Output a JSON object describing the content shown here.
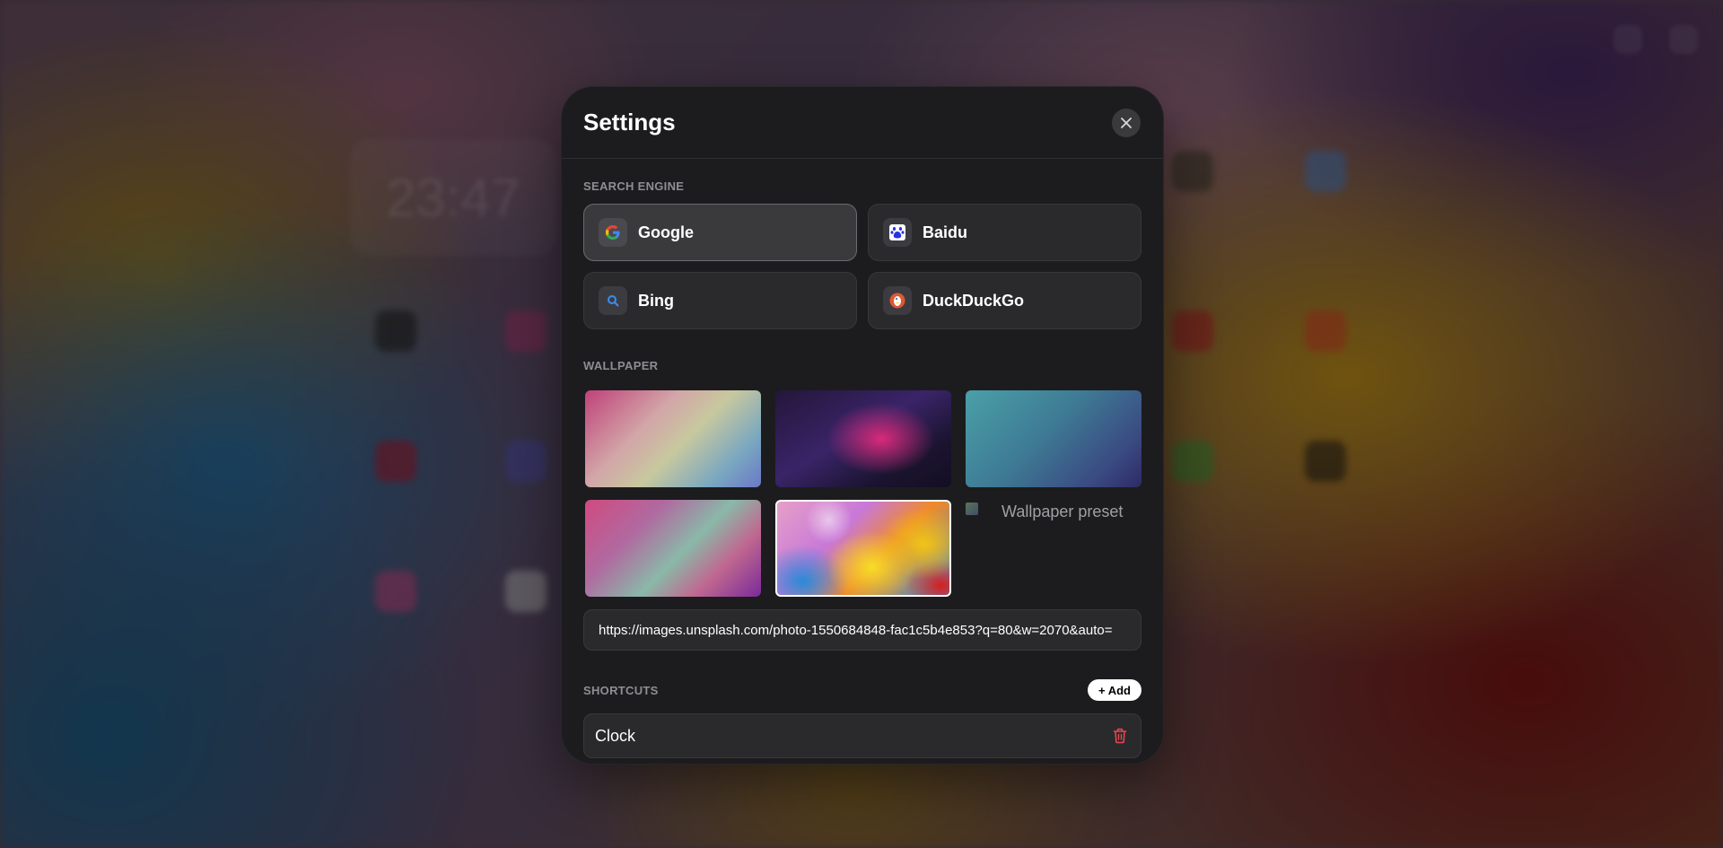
{
  "modal": {
    "title": "Settings",
    "close_icon": "close-icon"
  },
  "search_engine": {
    "label": "SEARCH ENGINE",
    "selected": "Google",
    "items": [
      {
        "name": "Google",
        "icon": "google-icon",
        "active": true
      },
      {
        "name": "Baidu",
        "icon": "baidu-icon",
        "active": false
      },
      {
        "name": "Bing",
        "icon": "search-icon",
        "active": false
      },
      {
        "name": "DuckDuckGo",
        "icon": "duckduckgo-icon",
        "active": false
      }
    ]
  },
  "wallpaper": {
    "label": "WALLPAPER",
    "preset_alt": "Wallpaper preset",
    "selected_index": 4,
    "url": "https://images.unsplash.com/photo-1550684848-fac1c5b4e853?q=80&w=2070&auto="
  },
  "shortcuts": {
    "label": "SHORTCUTS",
    "add_label": "+ Add",
    "items": [
      {
        "name": "Clock",
        "delete_icon": "trash-icon"
      }
    ]
  },
  "background": {
    "clock_ghost": "23:47"
  },
  "colors": {
    "modal_bg": "#1c1c1e",
    "card_bg": "#2a2a2d",
    "danger": "#e5484d",
    "label": "#8e8e93"
  }
}
